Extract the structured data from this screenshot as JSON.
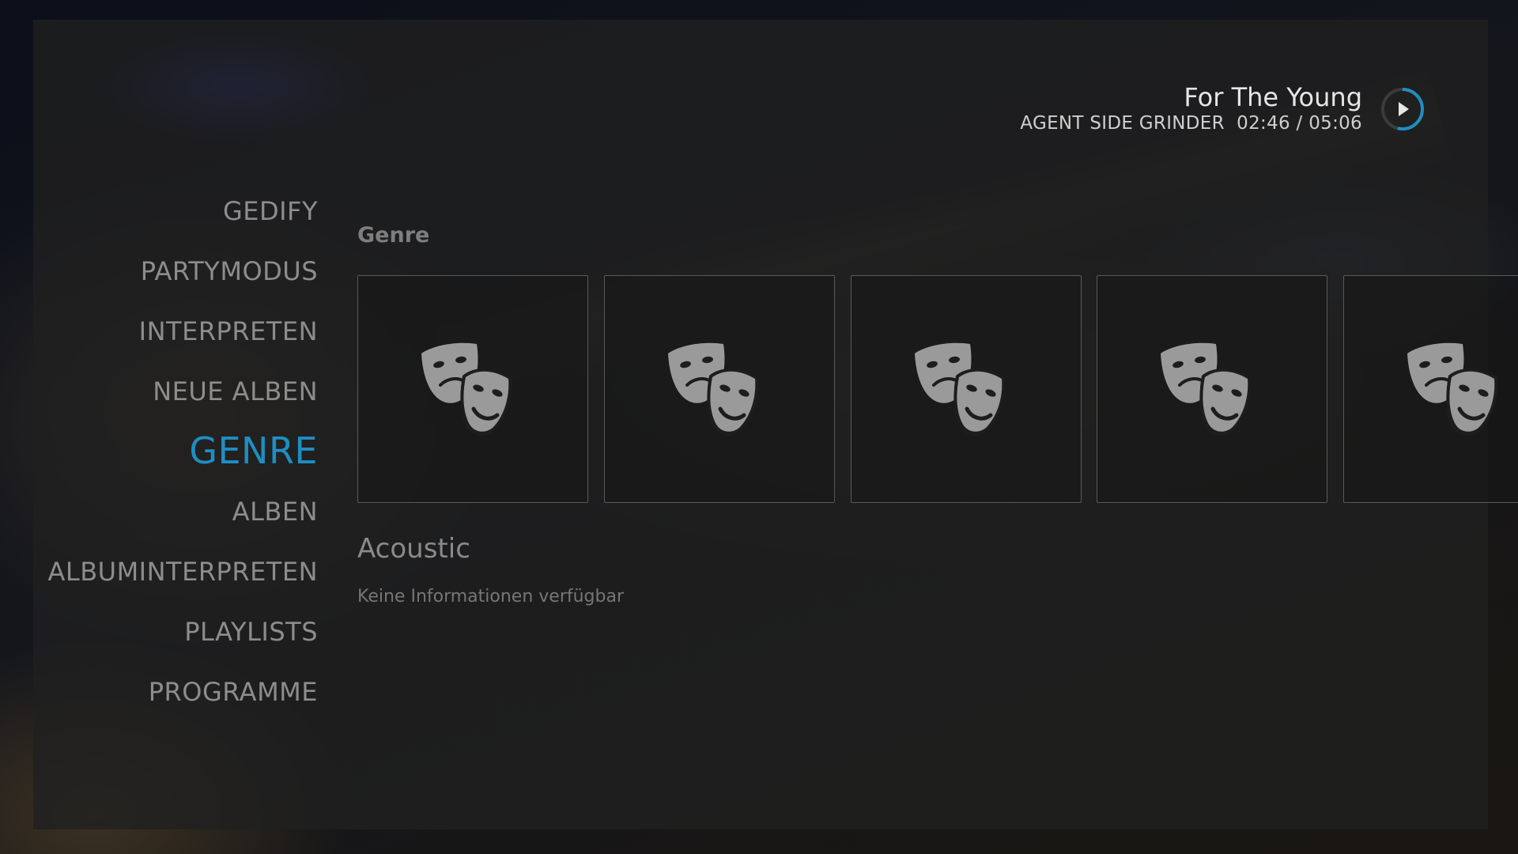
{
  "now_playing": {
    "title": "For The Young",
    "artist": "AGENT SIDE GRINDER",
    "time": "02:46 / 05:06",
    "progress_fraction": 0.54,
    "icon": "play-icon",
    "accent_color": "#1e8ec4"
  },
  "nav": {
    "items": [
      {
        "label": "GEDIFY"
      },
      {
        "label": "PARTYMODUS"
      },
      {
        "label": "INTERPRETEN"
      },
      {
        "label": "NEUE ALBEN"
      },
      {
        "label": "GENRE"
      },
      {
        "label": "ALBEN"
      },
      {
        "label": "ALBUMINTERPRETEN"
      },
      {
        "label": "PLAYLISTS"
      },
      {
        "label": "PROGRAMME"
      }
    ],
    "active_index": 4
  },
  "content": {
    "section_label": "Genre",
    "tile_icon": "theater-masks-icon",
    "tile_count": 5,
    "selected_title": "Acoustic",
    "selected_description": "Keine Informationen verfügbar"
  },
  "colors": {
    "accent": "#1e8ec4",
    "nav_text": "#8d8d8d",
    "icon": "#9a9a9a"
  }
}
